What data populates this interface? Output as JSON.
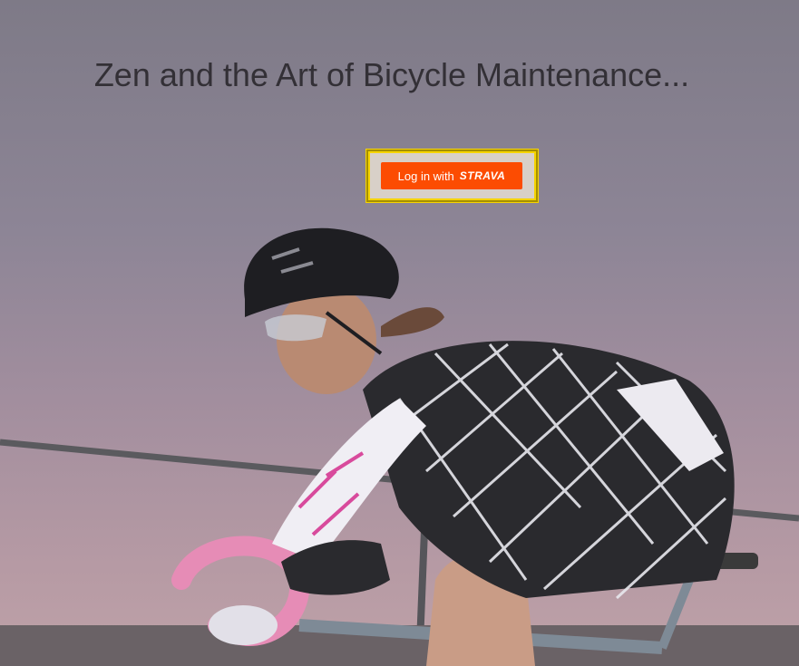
{
  "page": {
    "title": "Zen and the Art of Bicycle Maintenance...",
    "login_button": {
      "label": "Log in with",
      "brand": "STRAVA"
    },
    "colors": {
      "strava": "#fc4c02",
      "frame": "#f6d400",
      "title": "#333036"
    },
    "hero_image": "cyclist-photo"
  }
}
